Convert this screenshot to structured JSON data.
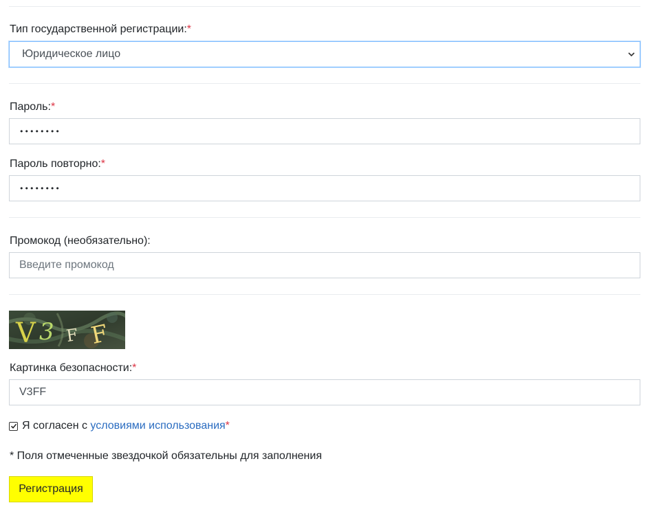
{
  "registration_type": {
    "label": "Тип государственной регистрации:",
    "required_mark": "*",
    "selected": "Юридическое лицо"
  },
  "password": {
    "label": "Пароль:",
    "required_mark": "*",
    "masked_value": "••••••••"
  },
  "password_repeat": {
    "label": "Пароль повторно:",
    "required_mark": "*",
    "masked_value": "••••••••"
  },
  "promo": {
    "label": "Промокод (необязательно):",
    "placeholder": "Введите промокод",
    "value": ""
  },
  "captcha": {
    "image_text": "V3FF",
    "label": "Картинка безопасности:",
    "required_mark": "*",
    "value": "V3FF"
  },
  "agreement": {
    "checked": true,
    "text_prefix": "Я согласен с ",
    "link_text": "условиями использования",
    "required_mark": "*"
  },
  "note": "* Поля отмеченные звездочкой обязательны для заполнения",
  "submit_label": "Регистрация",
  "colors": {
    "required": "#dc3545",
    "link": "#2a6cc0",
    "button_bg": "#ffff00",
    "focus_border": "#80bdff"
  }
}
